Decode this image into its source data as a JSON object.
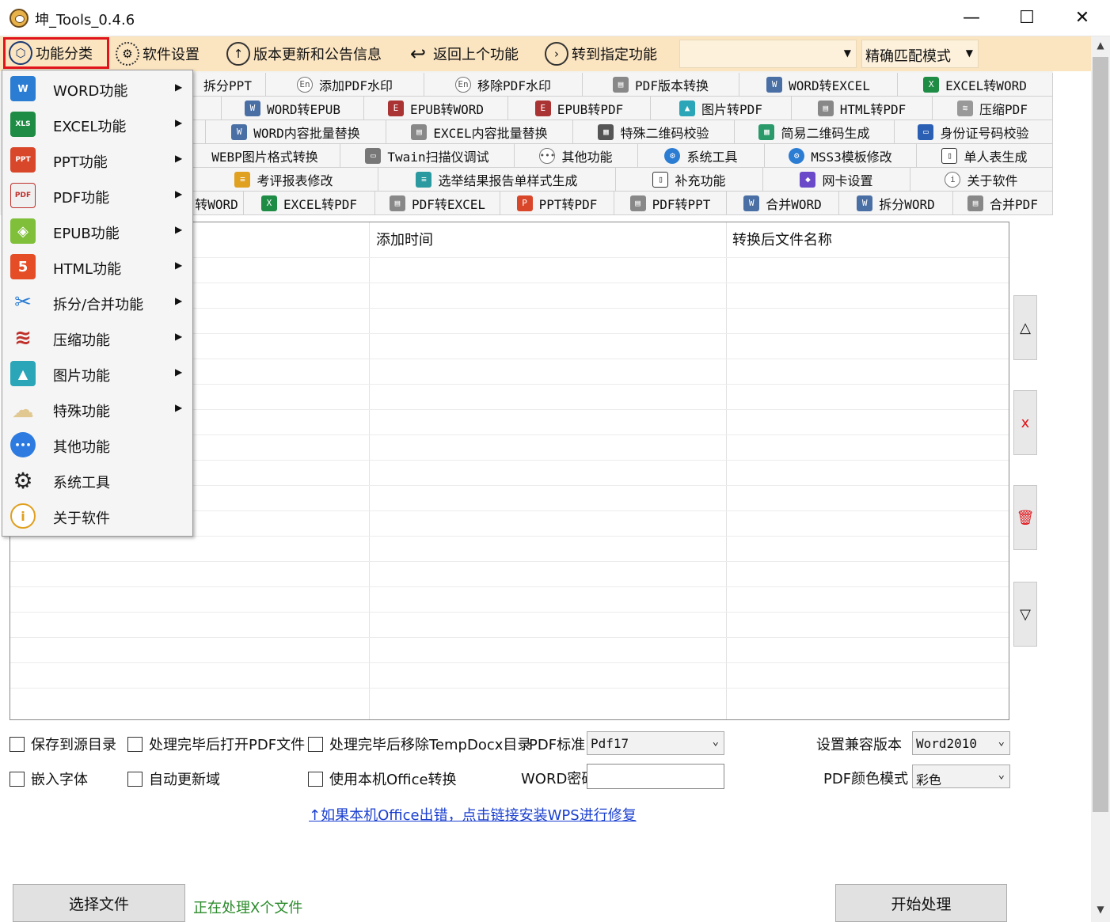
{
  "window": {
    "title": "坤_Tools_0.4.6",
    "minimize": "—",
    "maximize": "☐",
    "close": "✕"
  },
  "toolbar": {
    "items": [
      {
        "label": "功能分类",
        "icon": "cube-icon"
      },
      {
        "label": "软件设置",
        "icon": "gear-icon"
      },
      {
        "label": "版本更新和公告信息",
        "icon": "arrow-up-circle-icon"
      },
      {
        "label": "返回上个功能",
        "icon": "back-arrow-icon"
      },
      {
        "label": "转到指定功能",
        "icon": "arrow-right-circle-icon"
      }
    ],
    "search_value": "",
    "match_mode": "精确匹配模式",
    "highlight_color": "#e0141a",
    "background": "#fbe4c0"
  },
  "tabs": {
    "row1": [
      "拆分PPT",
      "添加PDF水印",
      "移除PDF水印",
      "PDF版本转换",
      "WORD转EXCEL",
      "EXCEL转WORD"
    ],
    "row2": [
      "WORD转EPUB",
      "EPUB转WORD",
      "EPUB转PDF",
      "图片转PDF",
      "HTML转PDF",
      "压缩PDF"
    ],
    "row3": [
      "WORD内容批量替换",
      "EXCEL内容批量替换",
      "特殊二维码校验",
      "简易二维码生成",
      "身份证号码校验"
    ],
    "row4": [
      "WEBP图片格式转换",
      "Twain扫描仪调试",
      "其他功能",
      "系统工具",
      "MSS3模板修改",
      "单人表生成"
    ],
    "row5": [
      "考评报表修改",
      "选举结果报告单样式生成",
      "补充功能",
      "网卡设置",
      "关于软件"
    ],
    "row6": [
      "转WORD",
      "EXCEL转PDF",
      "PDF转EXCEL",
      "PPT转PDF",
      "PDF转PPT",
      "合并WORD",
      "拆分WORD",
      "合并PDF"
    ]
  },
  "filelist": {
    "columns": [
      "添加时间",
      "转换后文件名称"
    ]
  },
  "side_buttons": [
    "△",
    "x",
    "🗑",
    "▽"
  ],
  "options": {
    "save_to_source": "保存到源目录",
    "open_pdf_after": "处理完毕后打开PDF文件",
    "remove_tempdocx": "处理完毕后移除TempDocx目录",
    "pdf_standard_label": "PDF标准",
    "pdf_standard_value": "Pdf17",
    "compat_label": "设置兼容版本",
    "compat_value": "Word2010",
    "embed_fonts": "嵌入字体",
    "auto_update_fields": "自动更新域",
    "use_local_office": "使用本机Office转换",
    "word_password_label": "WORD密码",
    "word_password_value": "",
    "pdf_color_label": "PDF颜色模式",
    "pdf_color_value": "彩色"
  },
  "wps_link": "↑如果本机Office出错，点击链接安装WPS进行修复",
  "buttons": {
    "select_file": "选择文件",
    "start": "开始处理"
  },
  "status": "正在处理X个文件",
  "menu": {
    "items": [
      {
        "label": "WORD功能",
        "icon": "word-icon",
        "color": "#2b7cd3",
        "glyph": "W",
        "submenu": true
      },
      {
        "label": "EXCEL功能",
        "icon": "excel-icon",
        "color": "#1e8c45",
        "glyph": "XLS",
        "submenu": true
      },
      {
        "label": "PPT功能",
        "icon": "ppt-icon",
        "color": "#d9472b",
        "glyph": "PPT",
        "submenu": true
      },
      {
        "label": "PDF功能",
        "icon": "pdf-icon",
        "color": "#e8e8e8",
        "glyph": "PDF",
        "submenu": true
      },
      {
        "label": "EPUB功能",
        "icon": "epub-icon",
        "color": "#7fbf3a",
        "glyph": "◈",
        "submenu": true
      },
      {
        "label": "HTML功能",
        "icon": "html5-icon",
        "color": "#e44d26",
        "glyph": "5",
        "submenu": true
      },
      {
        "label": "拆分/合并功能",
        "icon": "scissors-icon",
        "color": "#ffffff",
        "glyph": "✂",
        "submenu": true
      },
      {
        "label": "压缩功能",
        "icon": "layers-icon",
        "color": "#ffffff",
        "glyph": "≋",
        "submenu": true
      },
      {
        "label": "图片功能",
        "icon": "image-icon",
        "color": "#2aa6b8",
        "glyph": "▲",
        "submenu": true
      },
      {
        "label": "特殊功能",
        "icon": "cloud-icon",
        "color": "#ffffff",
        "glyph": "☁",
        "submenu": true
      },
      {
        "label": "其他功能",
        "icon": "more-icon",
        "color": "#2d7be0",
        "glyph": "•••",
        "submenu": false
      },
      {
        "label": "系统工具",
        "icon": "gear-icon",
        "color": "#ffffff",
        "glyph": "⚙",
        "submenu": false
      },
      {
        "label": "关于软件",
        "icon": "info-icon",
        "color": "#ffffff",
        "glyph": "i",
        "submenu": false
      }
    ]
  }
}
